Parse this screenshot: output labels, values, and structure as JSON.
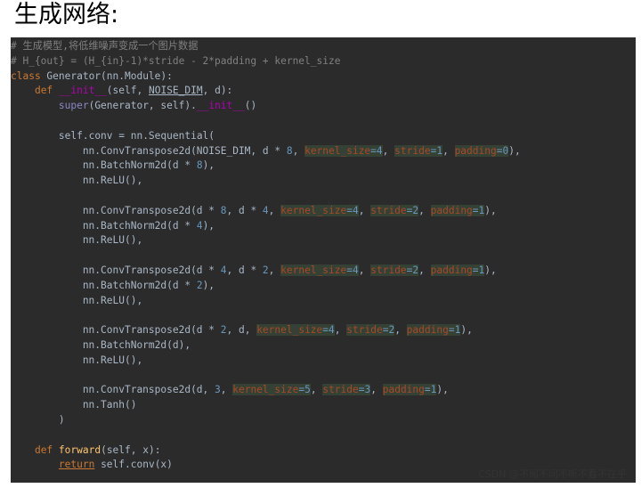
{
  "heading": "生成网络:",
  "watermark": "CSDN @不闻不问不听不看不在乎",
  "code": {
    "colors": {
      "background": "#2b2b2b",
      "default": "#a9b7c6",
      "comment": "#808080",
      "keyword": "#cc7832",
      "self": "#94558d",
      "number": "#6897bb",
      "magic": "#b200b2",
      "function": "#ffc66d",
      "builtin": "#8888c6",
      "kwarg": "#aa4926",
      "kwarg_highlight": "#344134"
    },
    "lines": [
      [
        {
          "t": "# 生成模型,将低维噪声变成一个图片数据",
          "c": "comment"
        }
      ],
      [
        {
          "t": "# H_{out} = (H_{in}-1)*stride - 2*padding + kernel_size",
          "c": "comment"
        }
      ],
      [
        {
          "t": "class ",
          "c": "keyword"
        },
        {
          "t": "Generator(nn.Module):"
        }
      ],
      [
        {
          "t": "    "
        },
        {
          "t": "def ",
          "c": "keyword"
        },
        {
          "t": "__init__",
          "c": "magic"
        },
        {
          "t": "("
        },
        {
          "t": "self",
          "c": "self"
        },
        {
          "t": ", "
        },
        {
          "t": "NOISE_DIM",
          "c": "underlined"
        },
        {
          "t": ", d):"
        }
      ],
      [
        {
          "t": "        "
        },
        {
          "t": "super",
          "c": "builtin"
        },
        {
          "t": "(Generator, "
        },
        {
          "t": "self",
          "c": "self"
        },
        {
          "t": ")."
        },
        {
          "t": "__init__",
          "c": "magic"
        },
        {
          "t": "()"
        }
      ],
      [],
      [
        {
          "t": "        "
        },
        {
          "t": "self",
          "c": "self"
        },
        {
          "t": ".conv = nn.Sequential("
        }
      ],
      [
        {
          "t": "            nn.ConvTranspose2d(NOISE_DIM, d * "
        },
        {
          "t": "8",
          "c": "number"
        },
        {
          "t": ", "
        },
        {
          "t": "kernel_size",
          "c": "kwarg"
        },
        {
          "t": "=",
          "c": "kwval"
        },
        {
          "t": "4",
          "c": "kwval"
        },
        {
          "t": ", "
        },
        {
          "t": "stride",
          "c": "kwarg"
        },
        {
          "t": "=",
          "c": "kwval"
        },
        {
          "t": "1",
          "c": "kwval"
        },
        {
          "t": ", "
        },
        {
          "t": "padding",
          "c": "kwarg"
        },
        {
          "t": "=",
          "c": "kwval"
        },
        {
          "t": "0",
          "c": "kwval"
        },
        {
          "t": "),"
        }
      ],
      [
        {
          "t": "            nn.BatchNorm2d(d * "
        },
        {
          "t": "8",
          "c": "number"
        },
        {
          "t": "),"
        }
      ],
      [
        {
          "t": "            nn.ReLU(),"
        }
      ],
      [],
      [
        {
          "t": "            nn.ConvTranspose2d(d * "
        },
        {
          "t": "8",
          "c": "number"
        },
        {
          "t": ", d * "
        },
        {
          "t": "4",
          "c": "number"
        },
        {
          "t": ", "
        },
        {
          "t": "kernel_size",
          "c": "kwarg"
        },
        {
          "t": "=",
          "c": "kwval"
        },
        {
          "t": "4",
          "c": "kwval"
        },
        {
          "t": ", "
        },
        {
          "t": "stride",
          "c": "kwarg"
        },
        {
          "t": "=",
          "c": "kwval"
        },
        {
          "t": "2",
          "c": "kwval"
        },
        {
          "t": ", "
        },
        {
          "t": "padding",
          "c": "kwarg"
        },
        {
          "t": "=",
          "c": "kwval"
        },
        {
          "t": "1",
          "c": "kwval"
        },
        {
          "t": "),"
        }
      ],
      [
        {
          "t": "            nn.BatchNorm2d(d * "
        },
        {
          "t": "4",
          "c": "number"
        },
        {
          "t": "),"
        }
      ],
      [
        {
          "t": "            nn.ReLU(),"
        }
      ],
      [],
      [
        {
          "t": "            nn.ConvTranspose2d(d * "
        },
        {
          "t": "4",
          "c": "number"
        },
        {
          "t": ", d * "
        },
        {
          "t": "2",
          "c": "number"
        },
        {
          "t": ", "
        },
        {
          "t": "kernel_size",
          "c": "kwarg"
        },
        {
          "t": "=",
          "c": "kwval"
        },
        {
          "t": "4",
          "c": "kwval"
        },
        {
          "t": ", "
        },
        {
          "t": "stride",
          "c": "kwarg"
        },
        {
          "t": "=",
          "c": "kwval"
        },
        {
          "t": "2",
          "c": "kwval"
        },
        {
          "t": ", "
        },
        {
          "t": "padding",
          "c": "kwarg"
        },
        {
          "t": "=",
          "c": "kwval"
        },
        {
          "t": "1",
          "c": "kwval"
        },
        {
          "t": "),"
        }
      ],
      [
        {
          "t": "            nn.BatchNorm2d(d * "
        },
        {
          "t": "2",
          "c": "number"
        },
        {
          "t": "),"
        }
      ],
      [
        {
          "t": "            nn.ReLU(),"
        }
      ],
      [],
      [
        {
          "t": "            nn.ConvTranspose2d(d * "
        },
        {
          "t": "2",
          "c": "number"
        },
        {
          "t": ", d, "
        },
        {
          "t": "kernel_size",
          "c": "kwarg"
        },
        {
          "t": "=",
          "c": "kwval"
        },
        {
          "t": "4",
          "c": "kwval"
        },
        {
          "t": ", "
        },
        {
          "t": "stride",
          "c": "kwarg"
        },
        {
          "t": "=",
          "c": "kwval"
        },
        {
          "t": "2",
          "c": "kwval"
        },
        {
          "t": ", "
        },
        {
          "t": "padding",
          "c": "kwarg"
        },
        {
          "t": "=",
          "c": "kwval"
        },
        {
          "t": "1",
          "c": "kwval"
        },
        {
          "t": "),"
        }
      ],
      [
        {
          "t": "            nn.BatchNorm2d(d),"
        }
      ],
      [
        {
          "t": "            nn.ReLU(),"
        }
      ],
      [],
      [
        {
          "t": "            nn.ConvTranspose2d(d, "
        },
        {
          "t": "3",
          "c": "number"
        },
        {
          "t": ", "
        },
        {
          "t": "kernel_size",
          "c": "kwarg"
        },
        {
          "t": "=",
          "c": "kwval"
        },
        {
          "t": "5",
          "c": "kwval"
        },
        {
          "t": ", "
        },
        {
          "t": "stride",
          "c": "kwarg"
        },
        {
          "t": "=",
          "c": "kwval"
        },
        {
          "t": "3",
          "c": "kwval"
        },
        {
          "t": ", "
        },
        {
          "t": "padding",
          "c": "kwarg"
        },
        {
          "t": "=",
          "c": "kwval"
        },
        {
          "t": "1",
          "c": "kwval"
        },
        {
          "t": "),"
        }
      ],
      [
        {
          "t": "            nn.Tanh()"
        }
      ],
      [
        {
          "t": "        )"
        }
      ],
      [],
      [
        {
          "t": "    "
        },
        {
          "t": "def ",
          "c": "keyword"
        },
        {
          "t": "forward",
          "c": "func"
        },
        {
          "t": "("
        },
        {
          "t": "self",
          "c": "self"
        },
        {
          "t": ", x):"
        }
      ],
      [
        {
          "t": "        "
        },
        {
          "t": "return",
          "c": "keyword underlined"
        },
        {
          "t": " "
        },
        {
          "t": "self",
          "c": "self"
        },
        {
          "t": ".conv(x)"
        }
      ]
    ]
  }
}
